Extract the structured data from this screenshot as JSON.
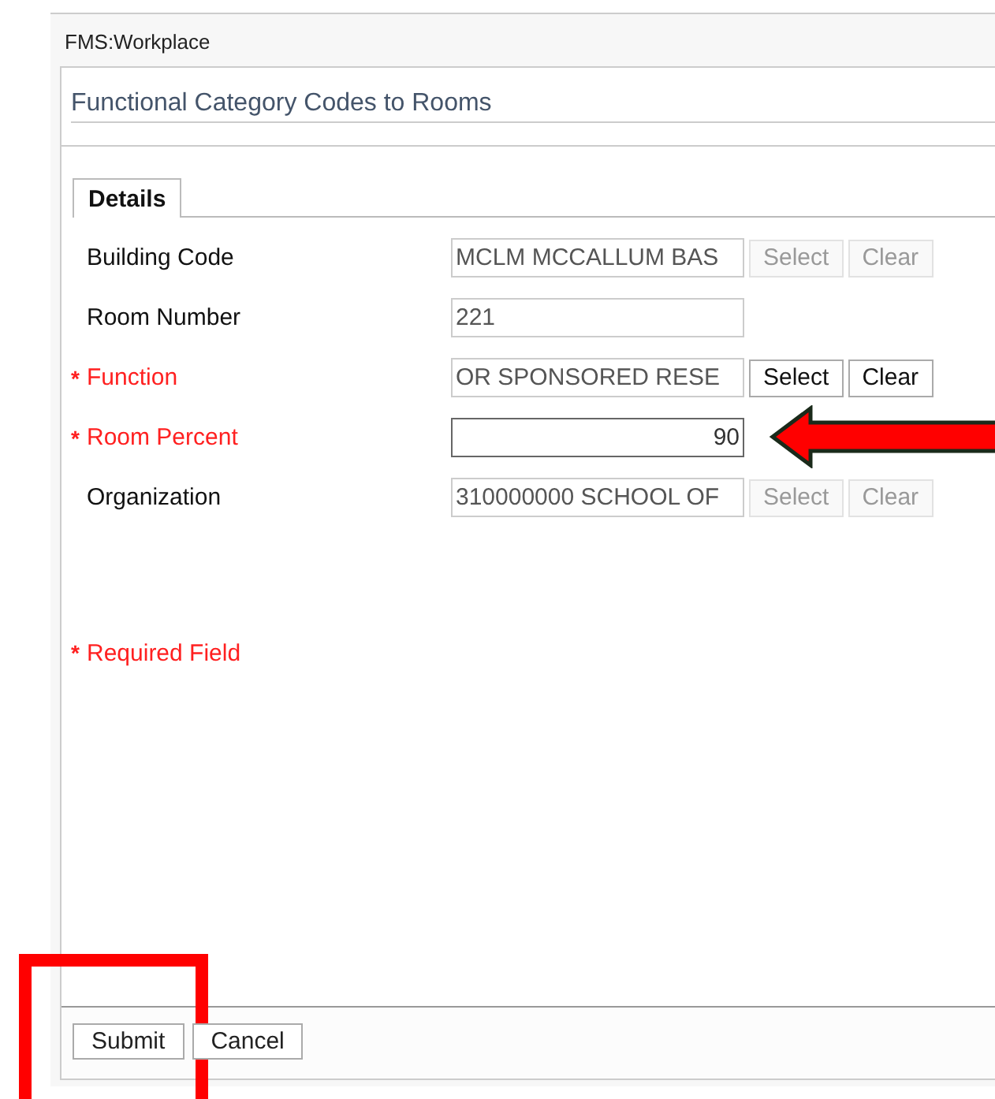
{
  "app_title": "FMS:Workplace",
  "form_title": "Functional Category Codes to Rooms",
  "tabs": [
    {
      "label": "Details",
      "selected": true
    }
  ],
  "fields": [
    {
      "label": "Building Code",
      "required": false,
      "kind": "lookup",
      "value": "MCLM MCCALLUM BAS",
      "focused": false,
      "buttons": [
        {
          "label": "Select",
          "disabled": true
        },
        {
          "label": "Clear",
          "disabled": true
        }
      ]
    },
    {
      "label": "Room Number",
      "required": false,
      "kind": "text",
      "value": "221",
      "focused": false
    },
    {
      "label": "Function",
      "required": true,
      "kind": "lookup",
      "value": "OR SPONSORED RESE",
      "focused": false,
      "buttons": [
        {
          "label": "Select",
          "disabled": false
        },
        {
          "label": "Clear",
          "disabled": false
        }
      ]
    },
    {
      "label": "Room Percent",
      "required": true,
      "kind": "number",
      "value": "90",
      "focused": true,
      "arrow_marker": true
    },
    {
      "label": "Organization",
      "required": false,
      "kind": "lookup",
      "value": "310000000 SCHOOL OF",
      "focused": false,
      "buttons": [
        {
          "label": "Select",
          "disabled": true
        },
        {
          "label": "Clear",
          "disabled": true
        }
      ]
    }
  ],
  "required_note": {
    "mark": "*",
    "text": "Required Field"
  },
  "required_mark": "*",
  "actions": [
    {
      "label": "Submit",
      "box_marker": true
    },
    {
      "label": "Cancel",
      "box_marker": false
    }
  ]
}
